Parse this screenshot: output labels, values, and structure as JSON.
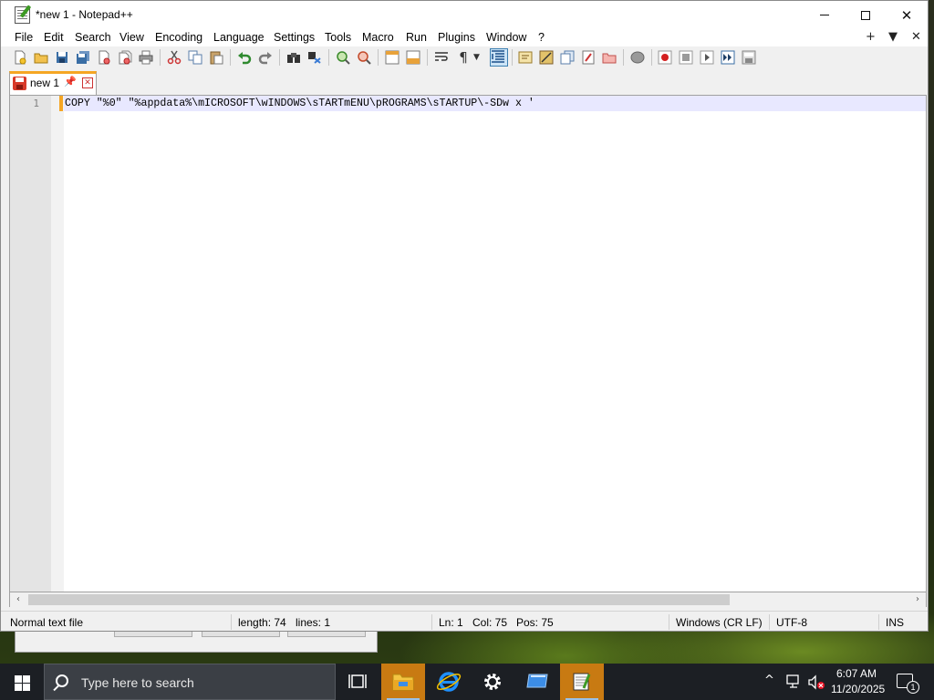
{
  "window": {
    "title": "*new 1 - Notepad++",
    "controls": {
      "minimize": "",
      "maximize": "",
      "close": "✕"
    }
  },
  "menubar": {
    "items": [
      "File",
      "Edit",
      "Search",
      "View",
      "Encoding",
      "Language",
      "Settings",
      "Tools",
      "Macro",
      "Run",
      "Plugins",
      "Window",
      "?"
    ],
    "right": {
      "plus": "+",
      "dropdown": "▼",
      "close": "✕"
    }
  },
  "toolbar": {
    "icons": [
      "new-file-icon",
      "open-file-icon",
      "save-icon",
      "save-all-icon",
      "close-icon",
      "close-all-icon",
      "print-icon",
      "cut-icon",
      "copy-icon",
      "paste-icon",
      "undo-icon",
      "redo-icon",
      "find-icon",
      "replace-icon",
      "zoom-in-icon",
      "zoom-out-icon",
      "sync-vertical-icon",
      "sync-horizontal-icon",
      "word-wrap-icon",
      "show-all-chars-icon",
      "indent-guide-icon",
      "user-language-icon",
      "doc-map-icon",
      "doc-list-icon",
      "function-list-icon",
      "folder-workspace-icon",
      "monitoring-icon",
      "record-macro-icon",
      "stop-record-icon",
      "play-macro-icon",
      "run-multiple-macro-icon",
      "save-macro-icon"
    ],
    "pilcrow": "¶",
    "dropdown_arrow": "▼"
  },
  "tabs": [
    {
      "label": "new 1",
      "pin": "📌",
      "close": "✕",
      "modified": true
    }
  ],
  "editor": {
    "lines": [
      {
        "number": "1",
        "text": "COPY \"%0\" \"%appdata%\\mICROSOFT\\wINDOWS\\sTARTmENU\\pROGRAMS\\sTARTUP\\-SDw x '"
      }
    ]
  },
  "scrollbar": {
    "left_arrow": "‹",
    "right_arrow": "›"
  },
  "statusbar": {
    "file_type": "Normal text file",
    "length": "length: 74",
    "lines": "lines: 1",
    "ln": "Ln: 1",
    "col": "Col: 75",
    "pos": "Pos: 75",
    "eol": "Windows (CR LF)",
    "encoding": "UTF-8",
    "mode": "INS"
  },
  "taskbar": {
    "search_placeholder": "Type here to search",
    "apps": [
      "task-view",
      "file-explorer",
      "internet-explorer",
      "settings",
      "remote-desktop",
      "notepad-plus-plus"
    ],
    "tray_chevron": "^",
    "time": "6:07 AM",
    "date": "11/20/2025",
    "notification_count": "1"
  },
  "colors": {
    "tab_accent": "#f5a623",
    "current_line": "#e8e8ff",
    "taskbar": "#1c1f24",
    "active_app": "#c87a12"
  }
}
